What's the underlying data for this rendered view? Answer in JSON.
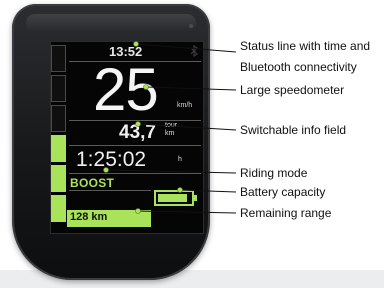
{
  "display": {
    "time": "13:52",
    "speed": "25",
    "speed_unit": "km/h",
    "info_value": "43,7",
    "info_unit_top": "tour",
    "info_unit_bottom": "km",
    "trip_time": "1:25:02",
    "trip_time_unit": "h",
    "riding_mode": "BOOST",
    "range": "128 km",
    "battery_fraction": 0.9,
    "assist_level_segments_on": 3,
    "assist_level_segments_total": 6,
    "accent_color": "#a8e35a"
  },
  "callouts": {
    "status_line_1": "Status line with time and",
    "status_line_2": "Bluetooth connectivity",
    "speedometer": "Large speedometer",
    "info_field": "Switchable info field",
    "riding_mode": "Riding mode",
    "battery": "Battery capacity",
    "range": "Remaining range"
  },
  "icons": {
    "bluetooth": "bluetooth-icon"
  }
}
